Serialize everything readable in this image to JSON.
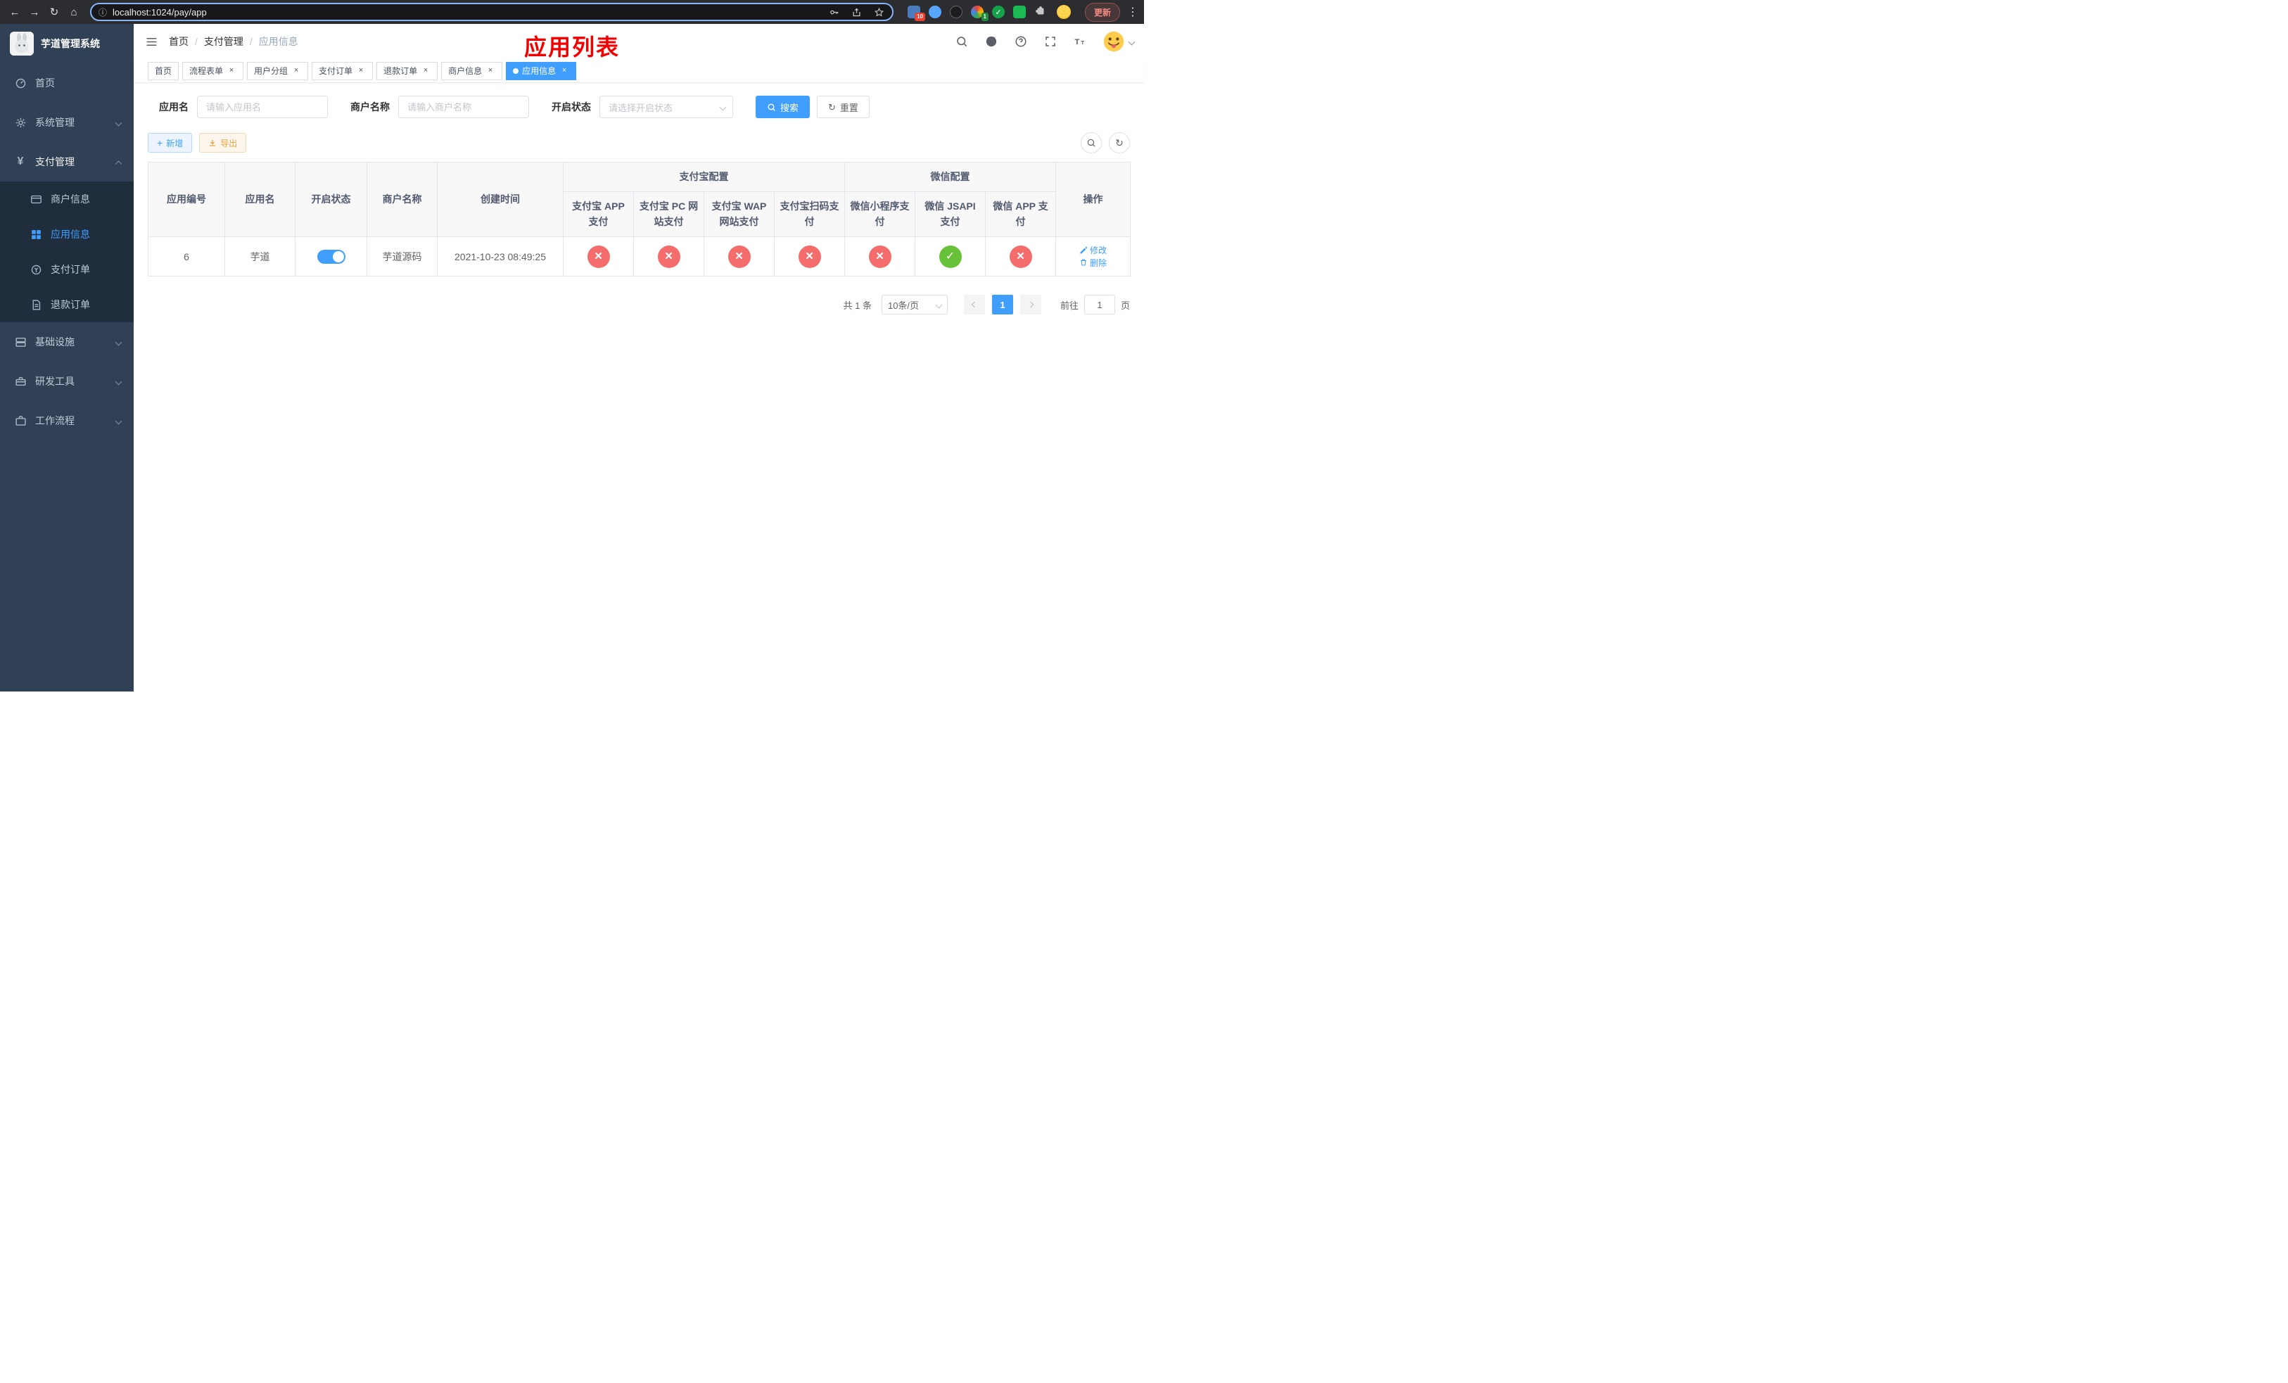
{
  "browser": {
    "url": "localhost:1024/pay/app",
    "update_label": "更新",
    "ext_badge_1": "10",
    "ext_badge_2": "1"
  },
  "sidebar": {
    "title": "芋道管理系统",
    "items": [
      {
        "label": "首页"
      },
      {
        "label": "系统管理"
      },
      {
        "label": "支付管理"
      },
      {
        "label": "基础设施"
      },
      {
        "label": "研发工具"
      },
      {
        "label": "工作流程"
      }
    ],
    "submenu": [
      {
        "label": "商户信息"
      },
      {
        "label": "应用信息"
      },
      {
        "label": "支付订单"
      },
      {
        "label": "退款订单"
      }
    ]
  },
  "breadcrumb": {
    "separator": "/",
    "items": [
      {
        "label": "首页"
      },
      {
        "label": "支付管理"
      },
      {
        "label": "应用信息"
      }
    ]
  },
  "page_title": "应用列表",
  "tabs": [
    {
      "label": "首页"
    },
    {
      "label": "流程表单"
    },
    {
      "label": "用户分组"
    },
    {
      "label": "支付订单"
    },
    {
      "label": "退款订单"
    },
    {
      "label": "商户信息"
    },
    {
      "label": "应用信息"
    }
  ],
  "filters": {
    "app_name_label": "应用名",
    "app_name_placeholder": "请输入应用名",
    "merchant_label": "商户名称",
    "merchant_placeholder": "请输入商户名称",
    "status_label": "开启状态",
    "status_placeholder": "请选择开启状态",
    "search_button": "搜索",
    "reset_button": "重置"
  },
  "toolbar": {
    "add_button": "新增",
    "export_button": "导出"
  },
  "table": {
    "group_alipay": "支付宝配置",
    "group_wechat": "微信配置",
    "columns": {
      "app_id": "应用编号",
      "app_name": "应用名",
      "status": "开启状态",
      "merchant": "商户名称",
      "created": "创建时间",
      "alipay_app": "支付宝 APP 支付",
      "alipay_pc": "支付宝 PC 网站支付",
      "alipay_wap": "支付宝 WAP 网站支付",
      "alipay_qr": "支付宝扫码支付",
      "wx_lite": "微信小程序支付",
      "wx_jsapi": "微信 JSAPI 支付",
      "wx_app": "微信 APP 支付",
      "actions": "操作"
    },
    "row": {
      "app_id": "6",
      "app_name": "芋道",
      "status_enabled": true,
      "merchant": "芋道源码",
      "created": "2021-10-23 08:49:25",
      "configs": {
        "alipay_app": false,
        "alipay_pc": false,
        "alipay_wap": false,
        "alipay_qr": false,
        "wx_lite": false,
        "wx_jsapi": true,
        "wx_app": false
      },
      "edit": "修改",
      "delete": "删除"
    }
  },
  "pagination": {
    "total": "共 1 条",
    "page_size": "10条/页",
    "page": "1",
    "goto_prefix": "前往",
    "goto_value": "1",
    "goto_suffix": "页"
  },
  "colors": {
    "primary": "#409EFF",
    "success": "#67C23A",
    "danger": "#F56C6C",
    "sidebar_bg": "#304156",
    "title_red": "#F20000"
  }
}
